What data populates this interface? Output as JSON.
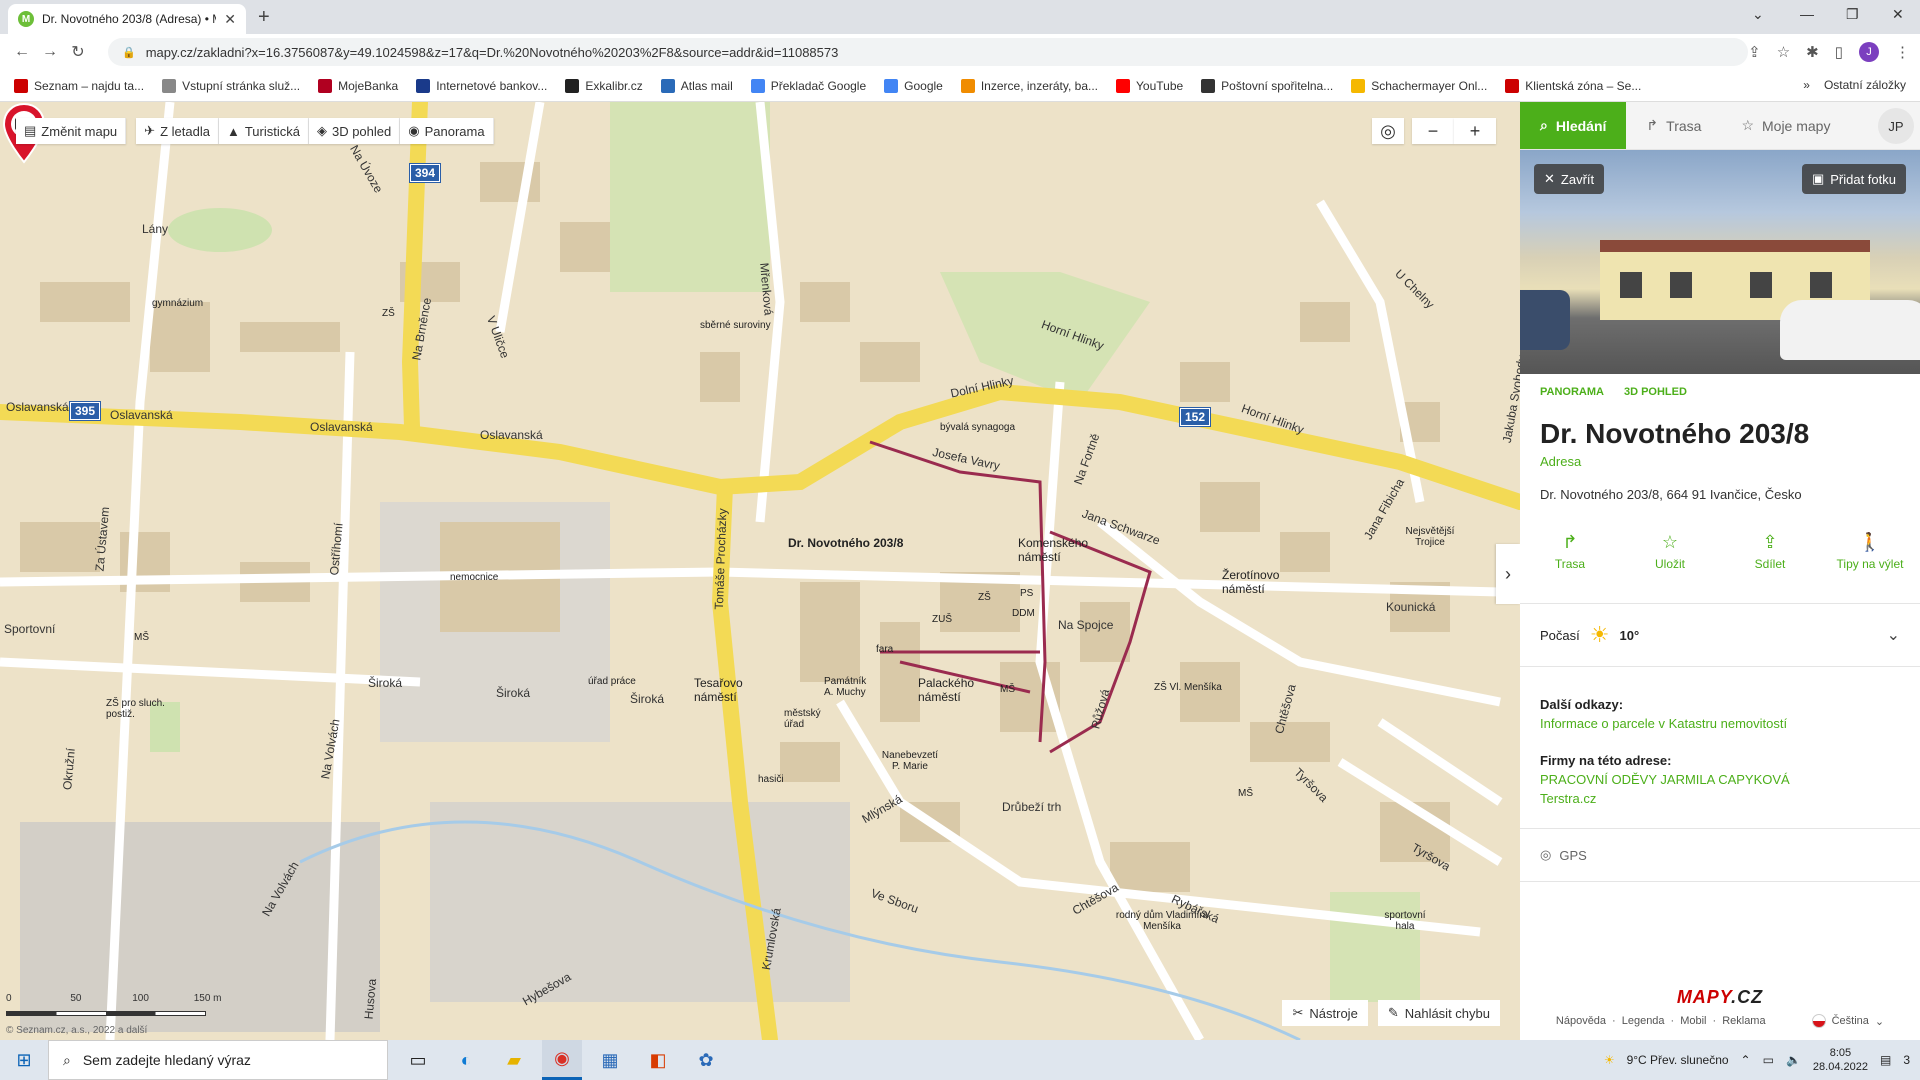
{
  "browser": {
    "tab_title": "Dr. Novotného 203/8 (Adresa) • M",
    "url": "mapy.cz/zakladni?x=16.3756087&y=49.1024598&z=17&q=Dr.%20Novotného%20203%2F8&source=addr&id=11088573",
    "bookmarks": [
      {
        "label": "Seznam – najdu ta...",
        "color": "#cc0000"
      },
      {
        "label": "Vstupní stránka služ...",
        "color": "#888888"
      },
      {
        "label": "MojeBanka",
        "color": "#b00020"
      },
      {
        "label": "Internetové bankov...",
        "color": "#1a3a8a"
      },
      {
        "label": "Exkalibr.cz",
        "color": "#222222"
      },
      {
        "label": "Atlas mail",
        "color": "#2a6ab8"
      },
      {
        "label": "Překladač Google",
        "color": "#4285f4"
      },
      {
        "label": "Google",
        "color": "#4285f4"
      },
      {
        "label": "Inzerce, inzeráty, ba...",
        "color": "#f08c00"
      },
      {
        "label": "YouTube",
        "color": "#ff0000"
      },
      {
        "label": "Poštovní spořitelna...",
        "color": "#333333"
      },
      {
        "label": "Schachermayer Onl...",
        "color": "#f5b800"
      },
      {
        "label": "Klientská zóna – Se...",
        "color": "#cc0000"
      }
    ],
    "bookmarks_more": "»",
    "other_bookmarks": "Ostatní záložky",
    "profile_initial": "J"
  },
  "map": {
    "toolbar": {
      "change_map": "Změnit mapu",
      "aerial": "Z letadla",
      "tourist": "Turistická",
      "view3d": "3D pohled",
      "panorama": "Panorama"
    },
    "zoom_out": "−",
    "zoom_in": "+",
    "pin_label": "Dr. Novotného 203/8",
    "road_numbers": [
      "394",
      "395",
      "152"
    ],
    "streets": [
      "Oslavanská",
      "Oslavanská",
      "Oslavanská",
      "Oslavanská",
      "Dolní Hlinky",
      "Horní Hlinky",
      "Horní Hlinky",
      "Široká",
      "Široká",
      "Široká",
      "Tesařovo náměstí",
      "Komenského náměstí",
      "Palackého náměstí",
      "Žerotínovo náměstí",
      "Na Spojce",
      "Jana Schwarze",
      "Kounická",
      "Mlýnská",
      "Drůbeží trh",
      "Ve Sboru",
      "Chtěšova",
      "Rybářská",
      "Tyršova",
      "Tyršova",
      "Krumlovská",
      "Tomáše Procházky",
      "Na Úvoze",
      "Na Brněnce",
      "V Uličce",
      "Mřenková",
      "Za Ústavem",
      "Ostříhomí",
      "Na Volvách",
      "Hybešova",
      "Okružní",
      "Sportovní",
      "Lány",
      "Na Volvách",
      "Husova",
      "U Chelny",
      "Jakuba Svobody",
      "Josefa Vavry",
      "Na Fortně",
      "Růžová",
      "Chtěšova",
      "Jana Fibicha"
    ],
    "pois": [
      "gymnázium",
      "sběrné suroviny",
      "bývalá synagoga",
      "nemocnice",
      "ZUŠ",
      "DDM",
      "PS",
      "ZŠ",
      "fara",
      "Památník A. Muchy",
      "městský úřad",
      "Nanebevzetí P. Marie",
      "hasiči",
      "úřad práce",
      "ZŠ pro sluch. postiž.",
      "MŠ",
      "ZŠ Vl. Menšíka",
      "rodný dům Vladimíra Menšíka",
      "sportovní hala",
      "Nejsvětější Trojice",
      "MŠ",
      "MŠ",
      "ZŠ"
    ],
    "tools": "Nástroje",
    "report_error": "Nahlásit chybu",
    "scale_labels": [
      "0",
      "50",
      "100",
      "150 m"
    ],
    "copyright": "© Seznam.cz, a.s., 2022 a další"
  },
  "panel": {
    "tabs": {
      "search": "Hledání",
      "route": "Trasa",
      "my_maps": "Moje mapy",
      "user_initials": "JP"
    },
    "close": "Zavřít",
    "add_photo": "Přidat fotku",
    "sublinks": [
      "PANORAMA",
      "3D POHLED"
    ],
    "title": "Dr. Novotného 203/8",
    "type": "Adresa",
    "address": "Dr. Novotného 203/8, 664 91 Ivančice, Česko",
    "actions": [
      {
        "label": "Trasa",
        "icon": "route-icon"
      },
      {
        "label": "Uložit",
        "icon": "star-icon"
      },
      {
        "label": "Sdílet",
        "icon": "share-icon"
      },
      {
        "label": "Tipy na výlet",
        "icon": "hiker-icon"
      }
    ],
    "weather_label": "Počasí",
    "weather_temp": "10°",
    "more_links_title": "Další odkazy:",
    "more_links": [
      "Informace o parcele v Katastru nemovitostí"
    ],
    "firms_title": "Firmy na této adrese:",
    "firms": [
      "PRACOVNÍ ODĚVY JARMILA CAPYKOVÁ",
      "Terstra.cz"
    ],
    "gps": "GPS",
    "footer_links": [
      "Nápověda",
      "Legenda",
      "Mobil",
      "Reklama"
    ],
    "language": "Čeština"
  },
  "taskbar": {
    "search_placeholder": "Sem zadejte hledaný výraz",
    "weather": "9°C  Přev. slunečno",
    "time": "8:05",
    "date": "28.04.2022",
    "notifications": "3"
  }
}
